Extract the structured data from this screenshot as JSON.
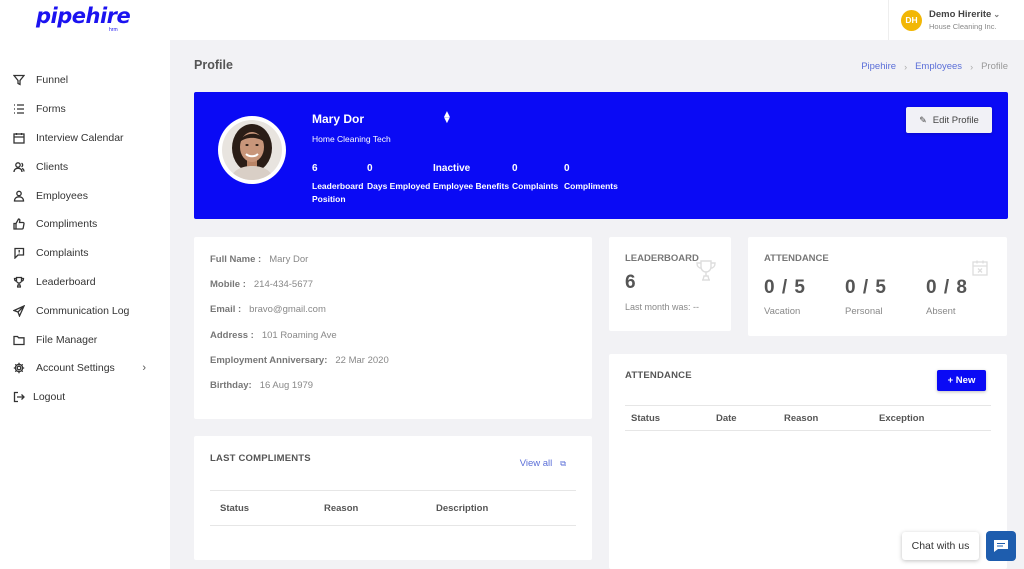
{
  "logo": {
    "text": "pipehire",
    "sub": "hrm"
  },
  "sidebar": {
    "items": [
      {
        "label": "Funnel",
        "icon": "funnel-icon"
      },
      {
        "label": "Forms",
        "icon": "list-icon"
      },
      {
        "label": "Interview Calendar",
        "icon": "calendar-icon"
      },
      {
        "label": "Clients",
        "icon": "clients-icon"
      },
      {
        "label": "Employees",
        "icon": "employees-icon"
      },
      {
        "label": "Compliments",
        "icon": "thumbs-up-icon"
      },
      {
        "label": "Complaints",
        "icon": "chat-alert-icon"
      },
      {
        "label": "Leaderboard",
        "icon": "trophy-icon"
      },
      {
        "label": "Communication Log",
        "icon": "send-icon"
      },
      {
        "label": "File Manager",
        "icon": "folder-icon"
      },
      {
        "label": "Account Settings",
        "icon": "gear-icon"
      },
      {
        "label": "Logout",
        "icon": "logout-icon"
      }
    ]
  },
  "user": {
    "initials": "DH",
    "name": "Demo Hirerite",
    "company": "House Cleaning Inc.",
    "avatar_color": "#f2b705"
  },
  "page": {
    "title": "Profile"
  },
  "breadcrumb": {
    "items": [
      "Pipehire",
      "Employees",
      "Profile"
    ]
  },
  "profile": {
    "name": "Mary Dor",
    "position": "Home Cleaning Tech",
    "edit_label": "Edit Profile",
    "banner_color": "#0a0af5",
    "stats": [
      {
        "value": "6",
        "label": "Leaderboard Position"
      },
      {
        "value": "0",
        "label": "Days Employed"
      },
      {
        "value": "Inactive",
        "label": "Employee Benefits"
      },
      {
        "value": "0",
        "label": "Complaints"
      },
      {
        "value": "0",
        "label": "Compliments"
      }
    ]
  },
  "details": [
    {
      "key": "Full Name :",
      "value": "Mary Dor"
    },
    {
      "key": "Mobile :",
      "value": "214-434-5677"
    },
    {
      "key": "Email :",
      "value": "bravo@gmail.com"
    },
    {
      "key": "Address :",
      "value": "101 Roaming Ave"
    },
    {
      "key": "Employment Anniversary:",
      "value": "22 Mar 2020"
    },
    {
      "key": "Birthday:",
      "value": "16 Aug 1979"
    }
  ],
  "leaderboard": {
    "title": "LEADERBOARD",
    "value": "6",
    "last_month": "Last month was: --"
  },
  "attendance_summary": {
    "title": "ATTENDANCE",
    "items": [
      {
        "value": "0 / 5",
        "label": "Vacation"
      },
      {
        "value": "0 / 5",
        "label": "Personal"
      },
      {
        "value": "0 / 8",
        "label": "Absent"
      }
    ]
  },
  "compliments": {
    "title": "LAST COMPLIMENTS",
    "view_all": "View all",
    "columns": [
      "Status",
      "Reason",
      "Description"
    ]
  },
  "attendance_table": {
    "title": "ATTENDANCE",
    "new_label": "+ New",
    "columns": [
      "Status",
      "Date",
      "Reason",
      "Exception"
    ]
  },
  "chat": {
    "label": "Chat with us"
  }
}
